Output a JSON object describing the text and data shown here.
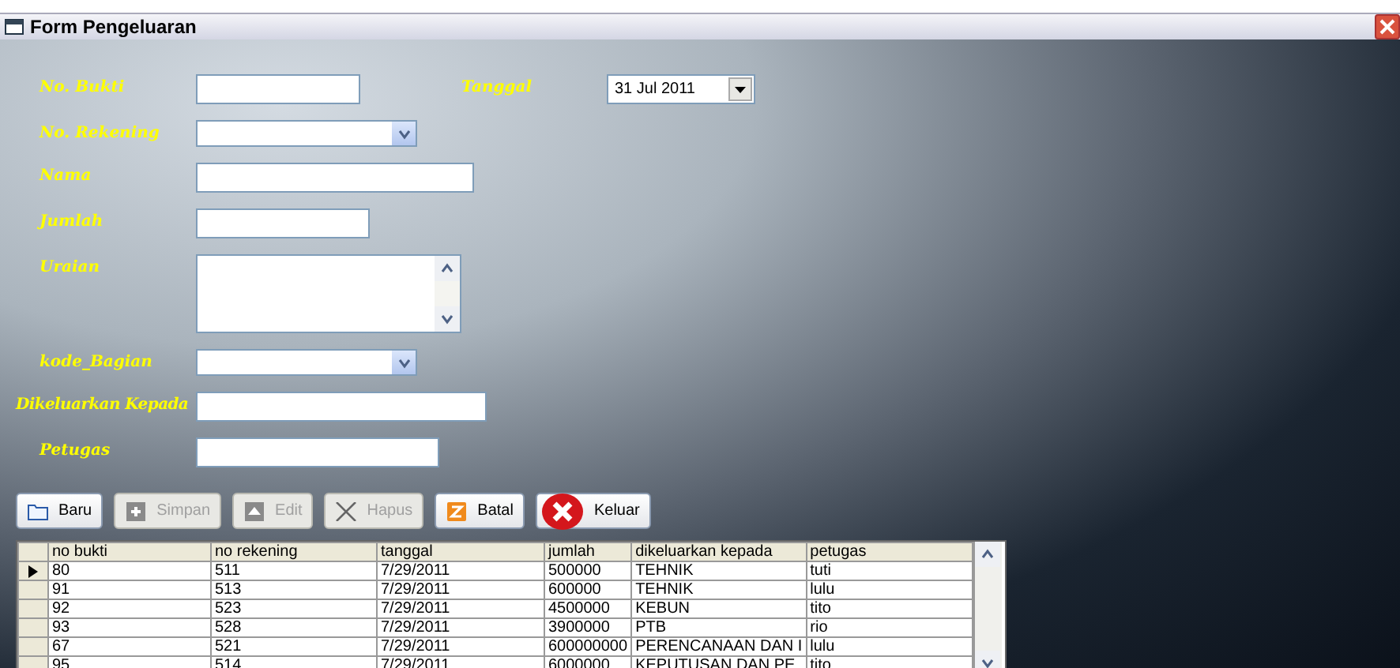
{
  "window": {
    "title": "Form Pengeluaran"
  },
  "date_field": {
    "label": "Tanggal",
    "value": "31 Jul 2011"
  },
  "fields": [
    {
      "label": "No. Bukti",
      "kind": "text"
    },
    {
      "label": "No. Rekening",
      "kind": "combo"
    },
    {
      "label": "Nama",
      "kind": "text"
    },
    {
      "label": "Jumlah",
      "kind": "text"
    },
    {
      "label": "Uraian",
      "kind": "textarea"
    },
    {
      "label": "kode_Bagian",
      "kind": "combo"
    },
    {
      "label": "Dikeluarkan Kepada",
      "kind": "text"
    },
    {
      "label": "Petugas",
      "kind": "text"
    }
  ],
  "buttons": [
    {
      "label": "Baru",
      "disabled": false
    },
    {
      "label": "Simpan",
      "disabled": true
    },
    {
      "label": "Edit",
      "disabled": true
    },
    {
      "label": "Hapus",
      "disabled": true
    },
    {
      "label": "Batal",
      "disabled": false
    },
    {
      "label": "Keluar",
      "disabled": false
    }
  ],
  "table": {
    "columns": [
      "no bukti",
      "no rekening",
      "tanggal",
      "jumlah",
      "dikeluarkan kepada",
      "petugas"
    ],
    "rows": [
      {
        "cells": [
          "80",
          "511",
          "7/29/2011",
          "500000",
          "TEHNIK",
          "tuti"
        ],
        "selected": true
      },
      {
        "cells": [
          "91",
          "513",
          "7/29/2011",
          "600000",
          "TEHNIK",
          "lulu"
        ],
        "selected": false
      },
      {
        "cells": [
          "92",
          "523",
          "7/29/2011",
          "4500000",
          "KEBUN",
          "tito"
        ],
        "selected": false
      },
      {
        "cells": [
          "93",
          "528",
          "7/29/2011",
          "3900000",
          "PTB",
          "rio"
        ],
        "selected": false
      },
      {
        "cells": [
          "67",
          "521",
          "7/29/2011",
          "600000000",
          "PERENCANAAN DAN I",
          "lulu"
        ],
        "selected": false
      },
      {
        "cells": [
          "95",
          "514",
          "7/29/2011",
          "6000000",
          "KEPUTUSAN DAN PE",
          "tito"
        ],
        "selected": false
      }
    ]
  }
}
